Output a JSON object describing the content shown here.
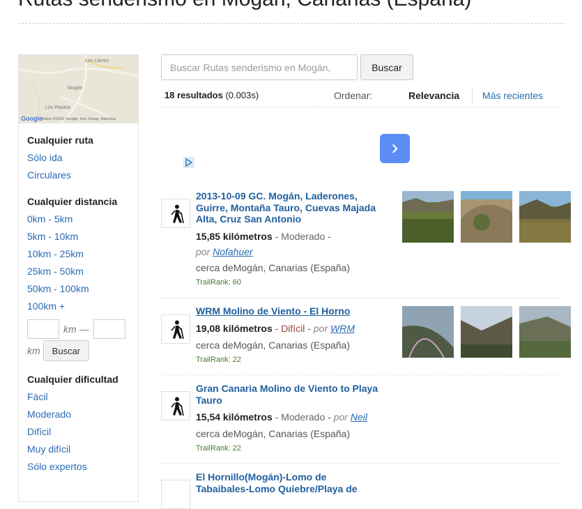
{
  "page": {
    "title": "Rutas senderismo en Mogán, Canarias (España)"
  },
  "map": {
    "labels": [
      "Los Llanos",
      "Mogán",
      "Los Pasitos"
    ],
    "google": "Google",
    "copyright": "Datos ©2016 Google, Inst. Geogr. Nacional"
  },
  "sidebar": {
    "route_head": "Cualquier ruta",
    "route_links": [
      "Sólo ida",
      "Circulares"
    ],
    "distance_head": "Cualquier distancia",
    "distance_links": [
      "0km - 5km",
      "5km - 10km",
      "10km - 25km",
      "25km - 50km",
      "50km - 100km",
      "100km +"
    ],
    "km_sep": "km —",
    "km_label": "km",
    "km_button": "Buscar",
    "difficulty_head": "Cualquier dificultad",
    "difficulty_links": [
      "Fácil",
      "Moderado",
      "Difícil",
      "Muy difícil",
      "Sólo expertos"
    ]
  },
  "search": {
    "placeholder": "Buscar Rutas senderismo en Mogán,",
    "button": "Buscar",
    "results_count": "18 resultados",
    "results_time": "(0.003s)",
    "sort_label": "Ordenar:",
    "sort_relevance": "Relevancia",
    "sort_recent": "Más recientes"
  },
  "results": [
    {
      "title": "2013-10-09 GC. Mogán, Laderones, Guirre, Montaña Tauro, Cuevas Majada Alta, Cruz San Antonio",
      "distance": "15,85 kilómetros",
      "difficulty": "Moderado",
      "por": "por",
      "author": "Nofahuer",
      "location": "cerca deMogán, Canarias (España)",
      "trailrank": "TrailRank: 60"
    },
    {
      "title": "WRM Molino de Viento - El Horno",
      "distance": "19,08 kilómetros",
      "difficulty": "Difícil",
      "por": "por",
      "author": "WRM",
      "location": "cerca deMogán, Canarias (España)",
      "trailrank": "TrailRank: 22"
    },
    {
      "title": "Gran Canaria Molino de Viento to Playa Tauro",
      "distance": "15,54 kilómetros",
      "difficulty": "Moderado",
      "por": "por",
      "author": "Neil",
      "location": "cerca deMogán, Canarias (España)",
      "trailrank": "TrailRank: 22"
    },
    {
      "title": "El Hornillo(Mogán)-Lomo de Tabaibales-Lomo Quiebre/Playa de"
    }
  ],
  "icons": {
    "hiker": "hiker-icon",
    "ad_next": "chevron-right-icon",
    "ad_choices": "adchoices-icon"
  },
  "colors": {
    "link": "#2a6ab3",
    "title_link": "#1f5f9e",
    "trailrank": "#4a7a2c",
    "ad_button": "#5b8df5"
  }
}
